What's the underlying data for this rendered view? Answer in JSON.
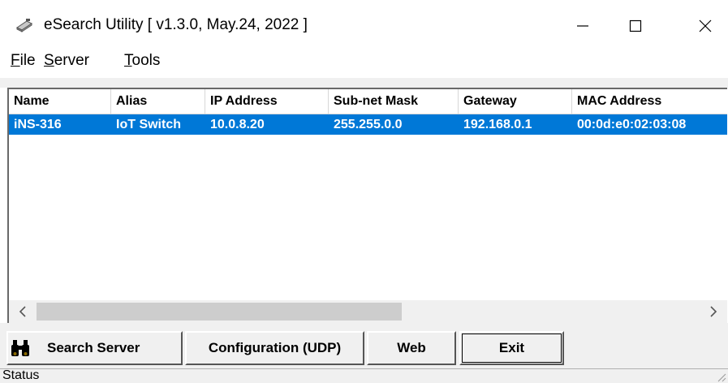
{
  "window": {
    "title": "eSearch Utility [ v1.3.0, May.24, 2022 ]",
    "app_icon": "network-device-icon",
    "controls": [
      "minimize-icon",
      "maximize-icon",
      "close-icon"
    ]
  },
  "menu": {
    "file": {
      "mnemonic": "F",
      "rest": "ile"
    },
    "server": {
      "mnemonic": "S",
      "rest": "erver"
    },
    "tools": {
      "mnemonic": "T",
      "rest": "ools"
    }
  },
  "table": {
    "columns": [
      "Name",
      "Alias",
      "IP Address",
      "Sub-net Mask",
      "Gateway",
      "MAC Address"
    ],
    "rows": [
      {
        "selected": true,
        "cells": [
          "iNS-316",
          "IoT Switch",
          "10.0.8.20",
          "255.255.0.0",
          "192.168.0.1",
          "00:0d:e0:02:03:08"
        ]
      }
    ]
  },
  "scrollbar": {
    "left_icon": "chevron-left-icon",
    "right_icon": "chevron-right-icon"
  },
  "buttons": {
    "search": "Search Server",
    "search_icon": "binoculars-icon",
    "config": "Configuration (UDP)",
    "web": "Web",
    "exit": "Exit"
  },
  "status": {
    "text": "Status"
  },
  "colors": {
    "selection": "#0078d7",
    "face": "#f0f0f0"
  }
}
